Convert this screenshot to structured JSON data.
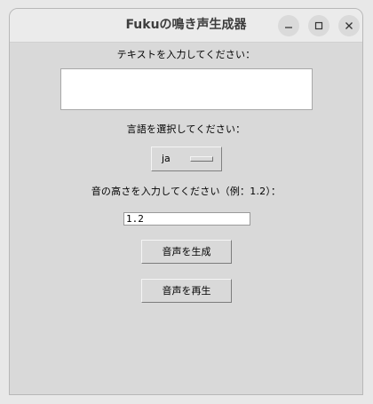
{
  "window": {
    "title": "Fukuの鳴き声生成器",
    "controls": {
      "minimize": "minimize-icon",
      "maximize": "maximize-icon",
      "close": "close-icon"
    }
  },
  "form": {
    "text_label": "テキストを入力してください：",
    "text_value": "",
    "language_label": "言語を選択してください：",
    "language_value": "ja",
    "pitch_label": "音の高さを入力してください（例：1.2）：",
    "pitch_value": "1.2",
    "generate_button": "音声を生成",
    "play_button": "音声を再生"
  }
}
